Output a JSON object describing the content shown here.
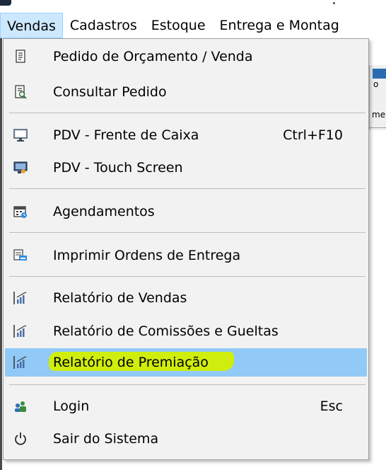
{
  "menubar": {
    "items": [
      {
        "label": "Vendas",
        "active": true
      },
      {
        "label": "Cadastros",
        "active": false
      },
      {
        "label": "Estoque",
        "active": false
      },
      {
        "label": "Entrega e Montag",
        "active": false
      }
    ]
  },
  "background": {
    "fragment_1": "o",
    "fragment_2": "me"
  },
  "dropdown": {
    "items": [
      {
        "label": "Pedido de Orçamento / Venda",
        "icon": "document-icon"
      },
      {
        "label": "Consultar Pedido",
        "icon": "search-document-icon"
      },
      {
        "label": "PDV - Frente de Caixa",
        "shortcut": "Ctrl+F10",
        "icon": "monitor-icon"
      },
      {
        "label": "PDV - Touch Screen",
        "icon": "touch-screen-icon"
      },
      {
        "label": "Agendamentos",
        "icon": "calendar-icon"
      },
      {
        "label": "Imprimir Ordens de Entrega",
        "icon": "print-delivery-icon"
      },
      {
        "label": "Relatório de Vendas",
        "icon": "bar-chart-icon"
      },
      {
        "label": "Relatório de Comissões e Gueltas",
        "icon": "bar-chart-icon"
      },
      {
        "label": "Relatório de Premiação",
        "icon": "bar-chart-icon",
        "highlighted": true,
        "highlight_marker_color": "#d4f000"
      },
      {
        "label": "Login",
        "shortcut": "Esc",
        "icon": "users-icon"
      },
      {
        "label": "Sair do Sistema",
        "icon": "power-icon"
      }
    ]
  },
  "colors": {
    "menubar_active_bg": "#cce8ff",
    "menu_item_highlight": "#91c9f7",
    "dropdown_bg": "#f2f2f2"
  }
}
